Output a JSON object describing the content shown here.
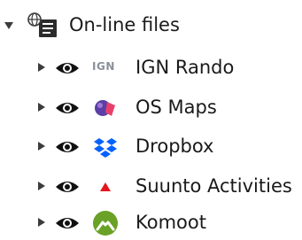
{
  "root": {
    "label": "On-line files",
    "expanded": true,
    "icon": "online-files-icon"
  },
  "items": [
    {
      "label": "IGN Rando",
      "icon": "ign-logo-icon",
      "icon_text": "IGN"
    },
    {
      "label": "OS Maps",
      "icon": "os-maps-logo-icon"
    },
    {
      "label": "Dropbox",
      "icon": "dropbox-logo-icon",
      "color": "#0061fe"
    },
    {
      "label": "Suunto Activities",
      "icon": "suunto-logo-icon",
      "color": "#e5141b"
    },
    {
      "label": "Komoot",
      "icon": "komoot-logo-icon",
      "color": "#6aa127"
    }
  ]
}
